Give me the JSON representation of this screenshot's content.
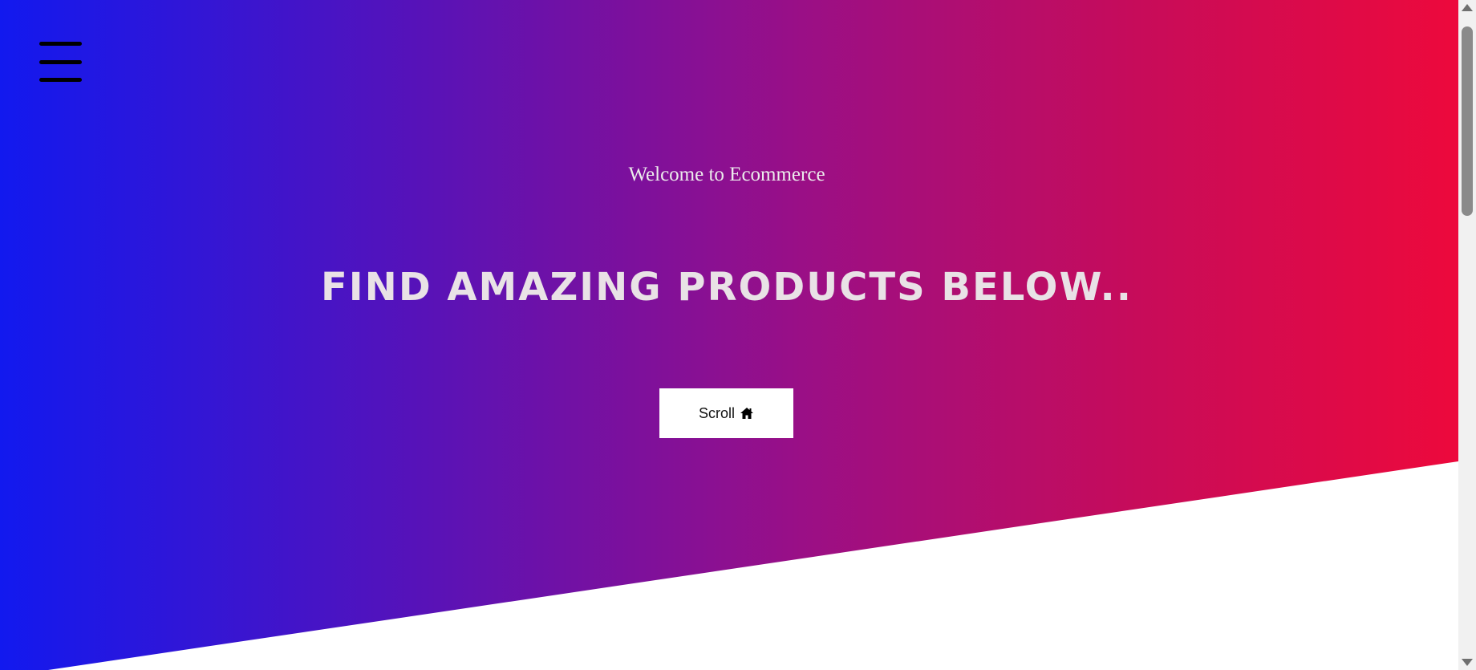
{
  "hero": {
    "welcome_text": "Welcome to Ecommerce",
    "headline": "FIND AMAZING PRODUCTS BELOW..",
    "scroll_button": {
      "label": "Scroll",
      "icon": "home-icon"
    },
    "gradient_colors": [
      "#1219ef",
      "#9a0f86",
      "#ed093c"
    ]
  },
  "nav": {
    "menu_icon": "hamburger-menu-icon"
  },
  "scrollbar": {
    "icon_up": "scroll-up-arrow-icon",
    "icon_down": "scroll-down-arrow-icon"
  }
}
